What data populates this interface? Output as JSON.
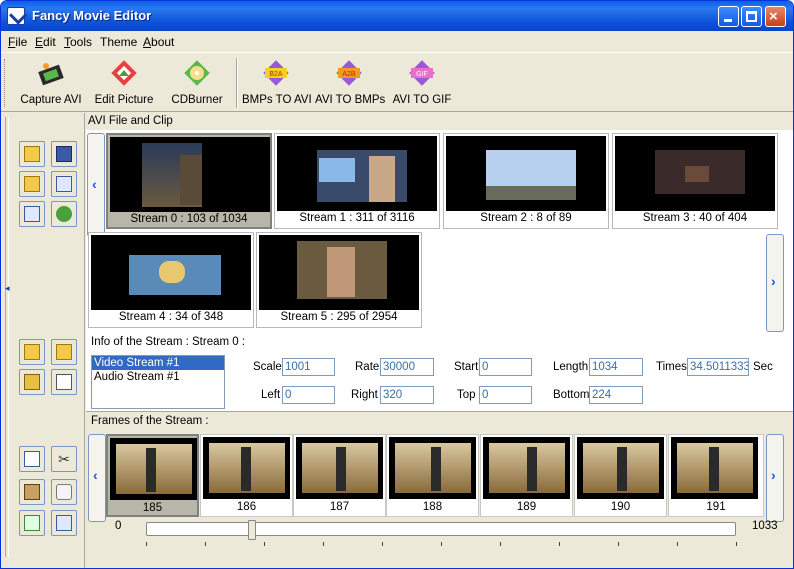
{
  "window": {
    "title": "Fancy Movie Editor",
    "minimize_label": "_",
    "maximize_label": "□",
    "close_label": "×"
  },
  "menu": [
    {
      "accel": "F",
      "rest": "ile"
    },
    {
      "accel": "E",
      "rest": "dit"
    },
    {
      "accel": "T",
      "rest": "ools"
    },
    {
      "accel": "",
      "rest": "Theme"
    },
    {
      "accel": "A",
      "rest": "bout"
    }
  ],
  "toolbar": {
    "items": [
      {
        "label": "Capture AVI",
        "icon": "film-camera-icon"
      },
      {
        "label": "Edit Picture",
        "icon": "picture-icon"
      },
      {
        "label": "CDBurner",
        "icon": "cd-icon"
      },
      {
        "label": "BMPs TO AVI",
        "icon": "b2a-icon"
      },
      {
        "label": "AVI TO BMPs",
        "icon": "a2b-icon"
      },
      {
        "label": "AVI TO GIF",
        "icon": "gif-icon"
      }
    ]
  },
  "clip_panel": {
    "header": "AVI File and Clip",
    "streams": [
      {
        "label": "Stream 0 : 103 of 1034",
        "selected": true
      },
      {
        "label": "Stream 1 : 311 of 3116",
        "selected": false
      },
      {
        "label": "Stream 2 : 8 of 89",
        "selected": false
      },
      {
        "label": "Stream 3 : 40 of 404",
        "selected": false
      },
      {
        "label": "Stream 4 : 34 of 348",
        "selected": false
      },
      {
        "label": "Stream 5 : 295 of 2954",
        "selected": false
      }
    ]
  },
  "stream_info": {
    "title": "Info of the Stream  : Stream 0 :",
    "list": [
      "Video Stream #1",
      "Audio Stream #1"
    ],
    "fields": {
      "scale": {
        "label": "Scale",
        "value": "1001"
      },
      "rate": {
        "label": "Rate",
        "value": "30000"
      },
      "start": {
        "label": "Start",
        "value": "0"
      },
      "length": {
        "label": "Length",
        "value": "1034"
      },
      "times": {
        "label": "Times",
        "value": "34.5011333"
      },
      "sec_label": "Sec",
      "left": {
        "label": "Left",
        "value": "0"
      },
      "right": {
        "label": "Right",
        "value": "320"
      },
      "top": {
        "label": "Top",
        "value": "0"
      },
      "bottom": {
        "label": "Bottom",
        "value": "224"
      }
    }
  },
  "frames": {
    "title": "Frames of the Stream :",
    "items": [
      "185",
      "186",
      "187",
      "188",
      "189",
      "190",
      "191"
    ],
    "slider_min": "0",
    "slider_max": "1033",
    "slider_value": 185
  },
  "colors": {
    "title_bar": "#0c53d8",
    "selection": "#316ac5",
    "field_text": "#3a6ea5"
  }
}
